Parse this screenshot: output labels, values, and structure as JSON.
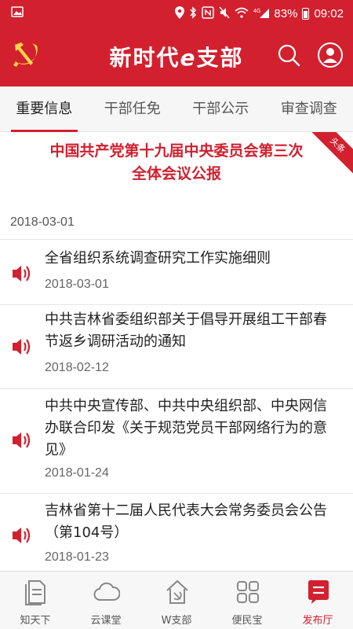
{
  "status_bar": {
    "battery": "83%",
    "time": "09:02",
    "network": "4G"
  },
  "app_bar": {
    "title_part1": "新时代",
    "title_e": "e",
    "title_part2": "支部"
  },
  "tabs": [
    {
      "label": "重要信息",
      "active": true
    },
    {
      "label": "干部任免",
      "active": false
    },
    {
      "label": "干部公示",
      "active": false
    },
    {
      "label": "审查调查",
      "active": false
    }
  ],
  "headline": {
    "title_line1": "中国共产党第十九届中央委员会第三次",
    "title_line2": "全体会议公报",
    "date": "2018-03-01",
    "badge": "头条"
  },
  "news": [
    {
      "title": "全省组织系统调查研究工作实施细则",
      "date": "2018-03-01"
    },
    {
      "title": "中共吉林省委组织部关于倡导开展组工干部春节返乡调研活动的通知",
      "date": "2018-02-12"
    },
    {
      "title": "中共中央宣传部、中共中央组织部、中央网信办联合印发《关于规范党员干部网络行为的意见》",
      "date": "2018-01-24"
    },
    {
      "title": "吉林省第十二届人民代表大会常务委员会公告（第104号）",
      "date": "2018-01-23"
    }
  ],
  "bottom_nav": [
    {
      "label": "知天下",
      "icon": "document-icon",
      "active": false
    },
    {
      "label": "云课堂",
      "icon": "cloud-icon",
      "active": false
    },
    {
      "label": "W支部",
      "icon": "house-emblem-icon",
      "active": false
    },
    {
      "label": "便民宝",
      "icon": "grid-icon",
      "active": false
    },
    {
      "label": "发布厅",
      "icon": "message-icon",
      "active": true
    }
  ],
  "colors": {
    "brand_red": "#d2202f",
    "background": "#ffffff",
    "tab_bar": "#f6f6f6"
  }
}
